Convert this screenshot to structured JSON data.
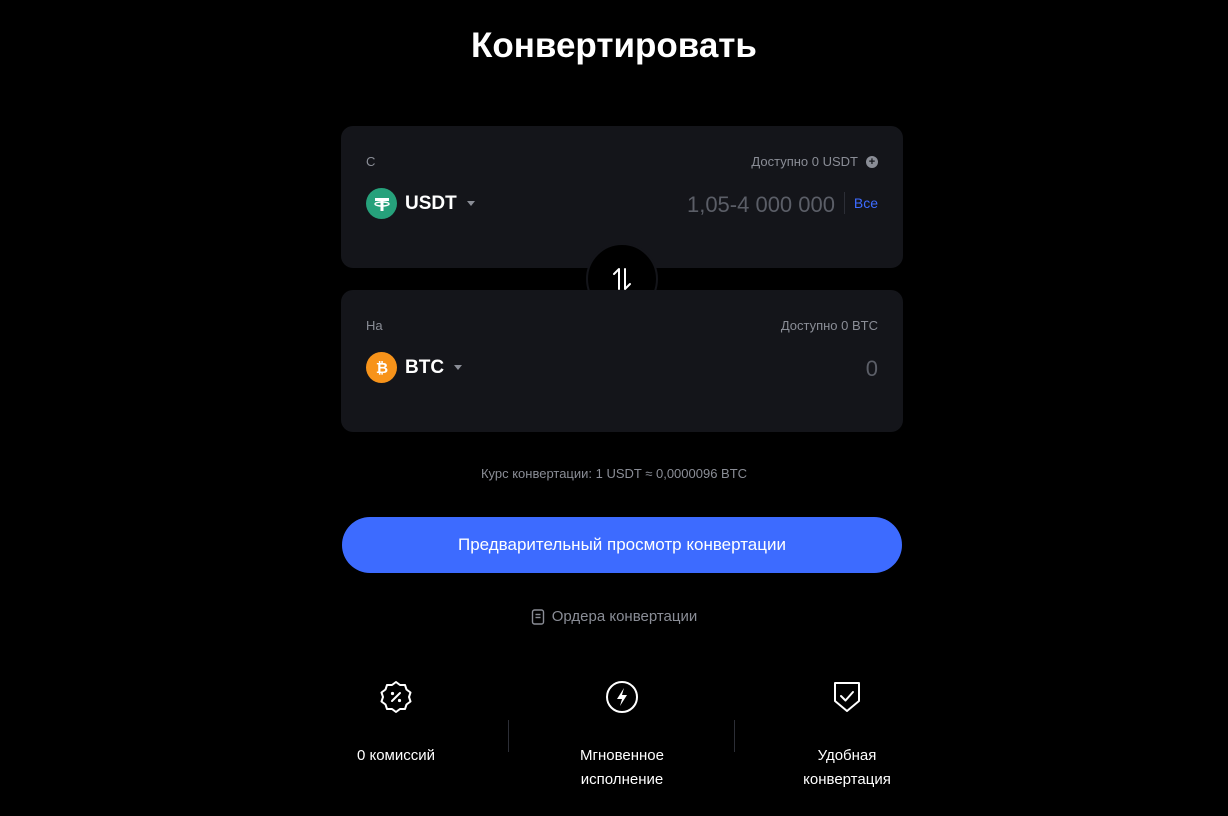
{
  "title": "Конвертировать",
  "from": {
    "label": "С",
    "available": "Доступно 0 USDT",
    "coin": "USDT",
    "amount_placeholder": "1,05-4 000 000",
    "all_label": "Все",
    "icon": "usdt-icon"
  },
  "to": {
    "label": "На",
    "available": "Доступно 0 BTC",
    "coin": "BTC",
    "amount_placeholder": "0",
    "icon": "btc-icon"
  },
  "rate": "Курс конвертации: 1 USDT ≈ 0,0000096 BTC",
  "preview_button": "Предварительный просмотр конвертации",
  "orders_link": "Ордера конвертации",
  "features": [
    {
      "text": "0 комиссий",
      "icon": "percent-badge-icon"
    },
    {
      "text": "Мгновенное исполнение",
      "icon": "lightning-icon"
    },
    {
      "text": "Удобная конвертация",
      "icon": "shield-check-icon"
    }
  ],
  "colors": {
    "background": "#000000",
    "card": "#14151a",
    "accent": "#3d6bff",
    "usdt": "#26a17b",
    "btc": "#f7931a"
  }
}
